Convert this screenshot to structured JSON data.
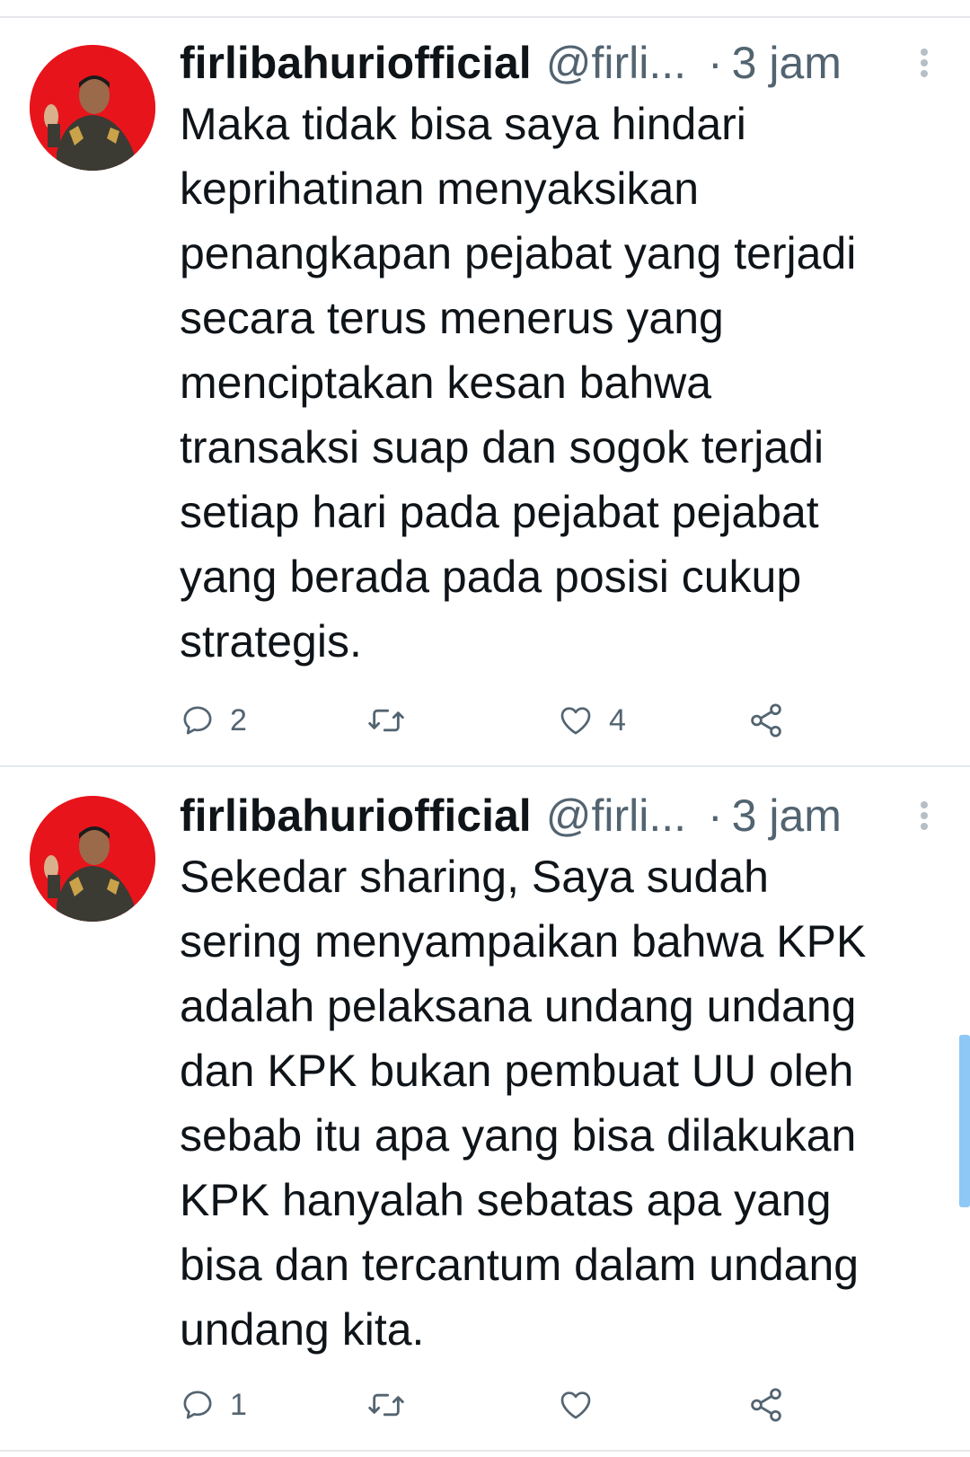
{
  "tweets": [
    {
      "display_name": "firlibahuriofficial",
      "handle": "@firli...",
      "separator": "·",
      "time": "3 jam",
      "text": "Maka tidak bisa saya hindari\nkeprihatinan menyaksikan\npenangkapan pejabat yang terjadi\nsecara terus menerus yang\nmenciptakan kesan bahwa\ntransaksi suap dan sogok terjadi\nsetiap hari pada pejabat pejabat\nyang berada pada posisi cukup\nstrategis.",
      "reply_count": "2",
      "retweet_count": "",
      "like_count": "4"
    },
    {
      "display_name": "firlibahuriofficial",
      "handle": "@firli...",
      "separator": "·",
      "time": "3 jam",
      "text": "Sekedar sharing, Saya sudah\nsering menyampaikan bahwa KPK\nadalah pelaksana undang undang\ndan KPK bukan pembuat UU oleh\nsebab itu apa yang bisa dilakukan\nKPK hanyalah sebatas apa yang\nbisa dan tercantum dalam undang\nundang kita.",
      "reply_count": "1",
      "retweet_count": "",
      "like_count": ""
    }
  ],
  "icons": {
    "reply": "reply-icon",
    "retweet": "retweet-icon",
    "like": "heart-icon",
    "share": "share-icon",
    "more": "more-vertical-icon"
  },
  "colors": {
    "text": "#0f1419",
    "muted": "#536471",
    "avatar_bg": "#e8141b",
    "divider": "#e4e7ea",
    "scrollbar": "#8ec8f6"
  }
}
